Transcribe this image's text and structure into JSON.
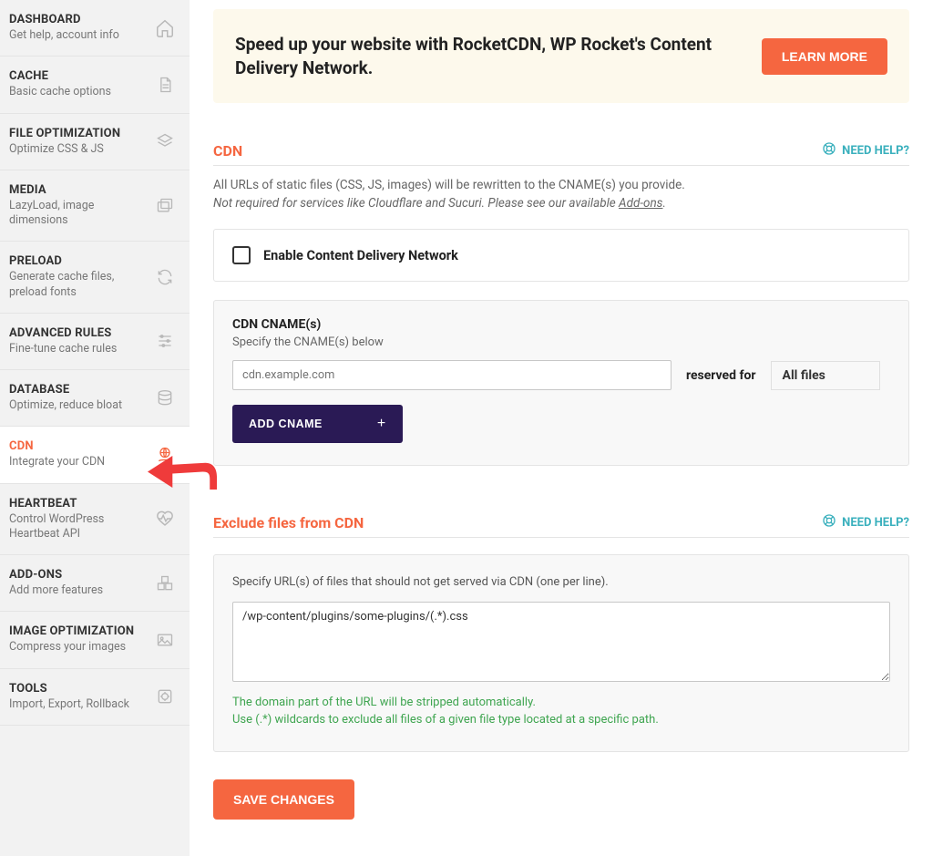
{
  "sidebar": {
    "items": [
      {
        "title": "DASHBOARD",
        "sub": "Get help, account info"
      },
      {
        "title": "CACHE",
        "sub": "Basic cache options"
      },
      {
        "title": "FILE OPTIMIZATION",
        "sub": "Optimize CSS & JS"
      },
      {
        "title": "MEDIA",
        "sub": "LazyLoad, image dimensions"
      },
      {
        "title": "PRELOAD",
        "sub": "Generate cache files, preload fonts"
      },
      {
        "title": "ADVANCED RULES",
        "sub": "Fine-tune cache rules"
      },
      {
        "title": "DATABASE",
        "sub": "Optimize, reduce bloat"
      },
      {
        "title": "CDN",
        "sub": "Integrate your CDN"
      },
      {
        "title": "HEARTBEAT",
        "sub": "Control WordPress Heartbeat API"
      },
      {
        "title": "ADD-ONS",
        "sub": "Add more features"
      },
      {
        "title": "IMAGE OPTIMIZATION",
        "sub": "Compress your images"
      },
      {
        "title": "TOOLS",
        "sub": "Import, Export, Rollback"
      }
    ]
  },
  "promo": {
    "text": "Speed up your website with RocketCDN, WP Rocket's Content Delivery Network.",
    "button": "LEARN MORE"
  },
  "need_help": "NEED HELP?",
  "cdn": {
    "title": "CDN",
    "desc1": "All URLs of static files (CSS, JS, images) will be rewritten to the CNAME(s) you provide.",
    "desc2_pre": "Not required for services like Cloudflare and Sucuri. Please see our available ",
    "desc2_link": "Add-ons",
    "desc2_post": ".",
    "checkbox_label": "Enable Content Delivery Network",
    "cname_head": "CDN CNAME(s)",
    "cname_desc": "Specify the CNAME(s) below",
    "cname_placeholder": "cdn.example.com",
    "reserved_label": "reserved for",
    "reserved_value": "All files",
    "add_cname": "ADD CNAME"
  },
  "exclude": {
    "title": "Exclude files from CDN",
    "desc": "Specify URL(s) of files that should not get served via CDN (one per line).",
    "value": "/wp-content/plugins/some-plugins/(.*).css",
    "hint1": "The domain part of the URL will be stripped automatically.",
    "hint2": "Use (.*) wildcards to exclude all files of a given file type located at a specific path."
  },
  "save": "SAVE CHANGES"
}
